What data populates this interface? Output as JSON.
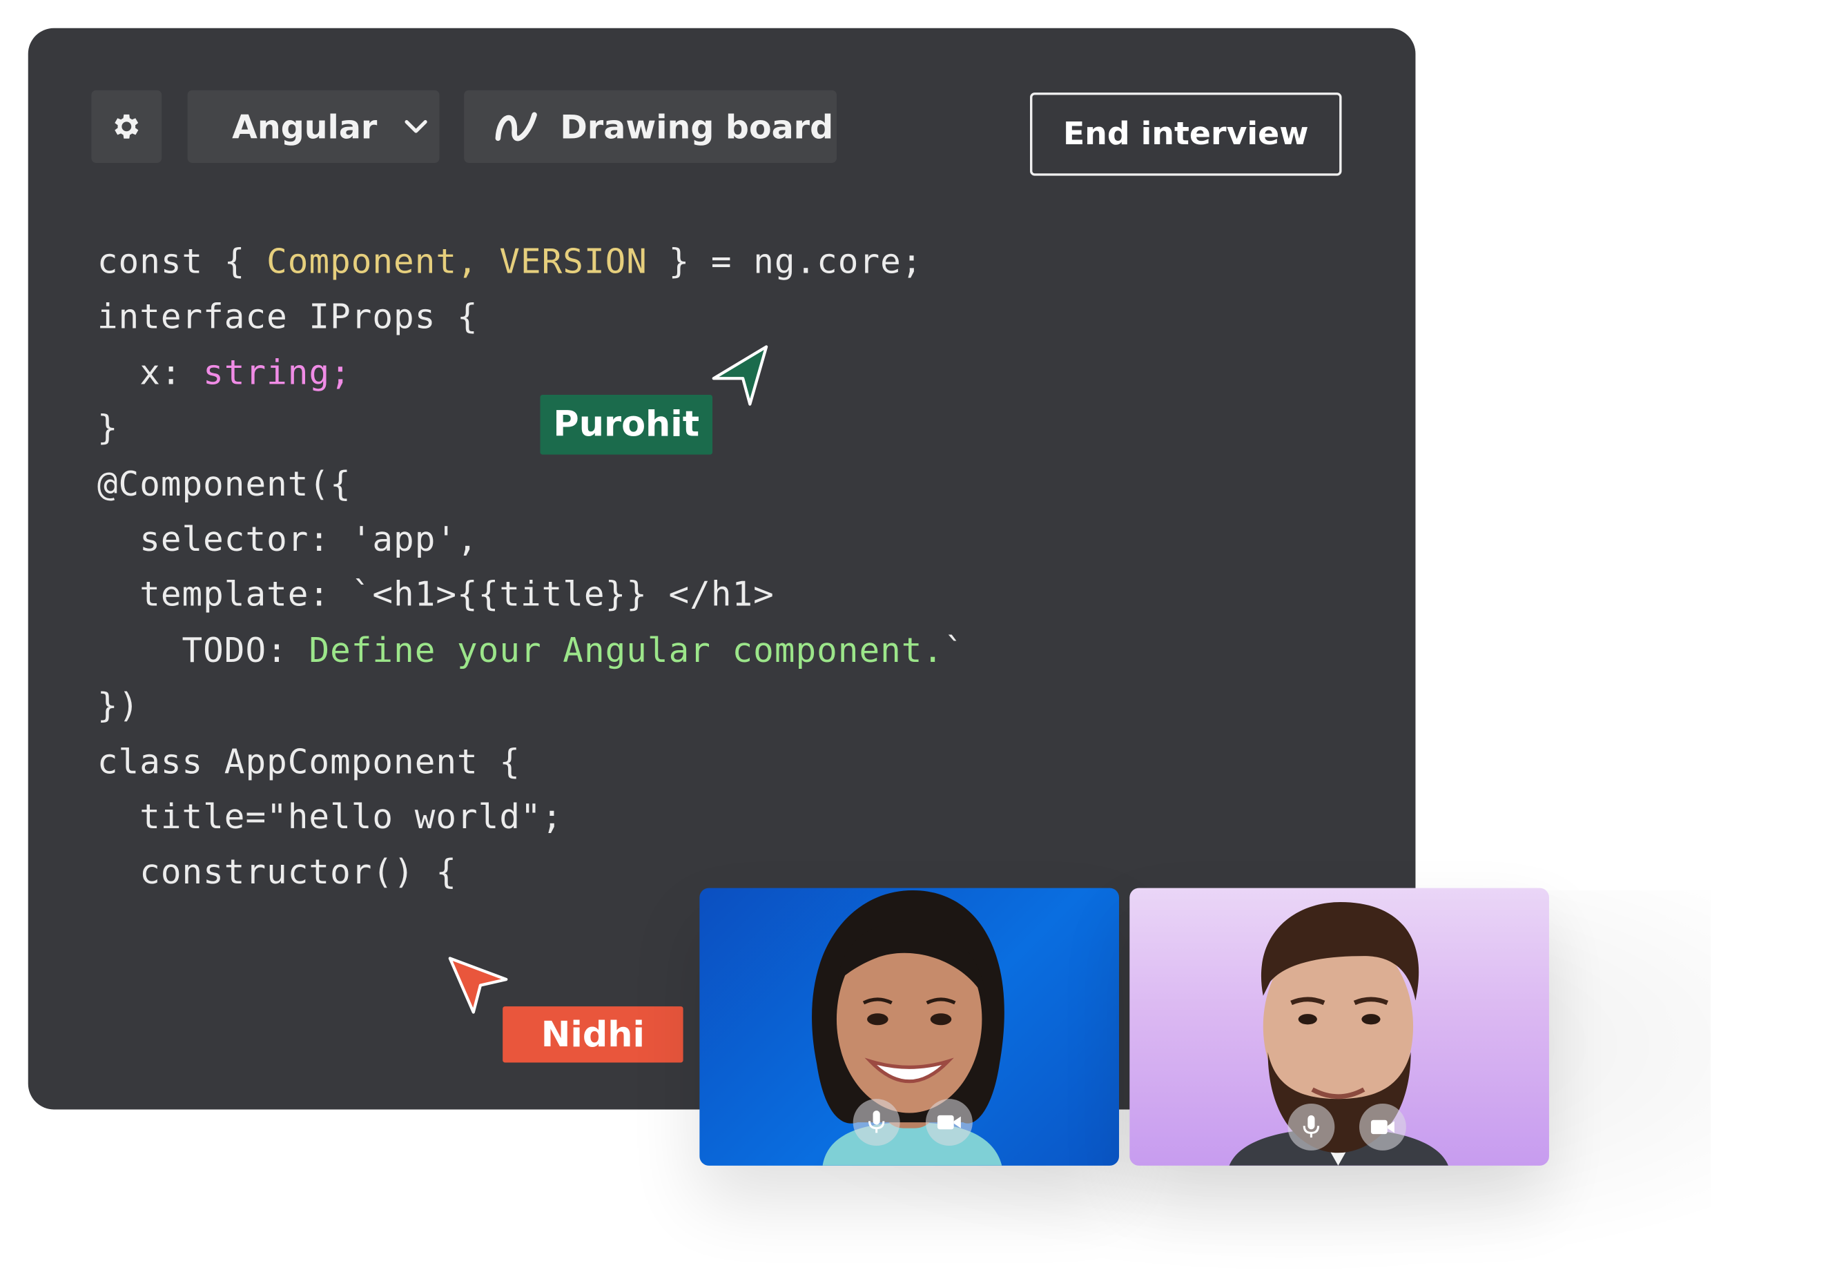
{
  "toolbar": {
    "settings_icon": "gear-icon",
    "language_label": "Angular",
    "language_chevron_icon": "chevron-down-icon",
    "drawing_icon": "squiggle-icon",
    "drawing_label": "Drawing board",
    "end_label": "End interview"
  },
  "editor": {
    "lines": [
      [
        {
          "t": "const { "
        },
        {
          "t": "Component, ",
          "c": "yellow"
        },
        {
          "t": "VERSION",
          "c": "yellow"
        },
        {
          "t": " } = ng.core;"
        }
      ],
      [
        {
          "t": "interface IProps {"
        }
      ],
      [
        {
          "t": "  x: "
        },
        {
          "t": "string;",
          "c": "pink"
        }
      ],
      [
        {
          "t": "}"
        }
      ],
      [
        {
          "t": "@Component({"
        }
      ],
      [
        {
          "t": "  selector: 'app',"
        }
      ],
      [
        {
          "t": "  template: `<h1>{{title}} </h1>"
        }
      ],
      [
        {
          "t": "    TODO: "
        },
        {
          "t": "Define your Angular component.",
          "c": "green"
        },
        {
          "t": "`"
        }
      ],
      [
        {
          "t": "})"
        }
      ],
      [
        {
          "t": "class AppComponent {"
        }
      ],
      [
        {
          "t": "  title=\"hello world\";"
        }
      ],
      [
        {
          "t": "  constructor() {"
        }
      ]
    ]
  },
  "collaborators": {
    "purohit": {
      "name": "Purohit",
      "color": "#1b6b4c"
    },
    "nidhi": {
      "name": "Nidhi",
      "color": "#e9563c"
    }
  },
  "video": {
    "participants": [
      {
        "mic_icon": "microphone-icon",
        "camera_icon": "video-camera-icon"
      },
      {
        "mic_icon": "microphone-icon",
        "camera_icon": "video-camera-icon"
      }
    ]
  }
}
